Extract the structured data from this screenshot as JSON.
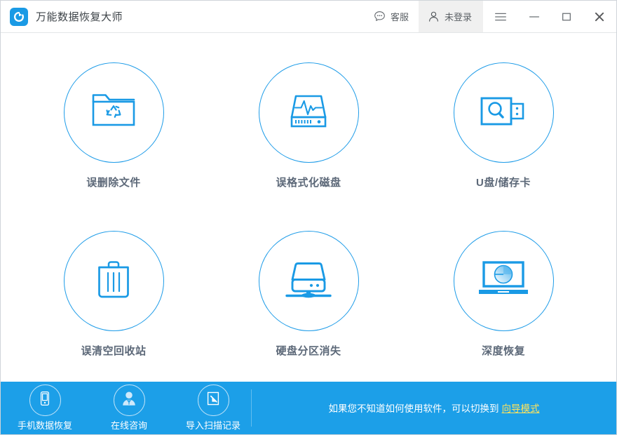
{
  "window": {
    "title": "万能数据恢复大师",
    "logo_icon": "refresh-circle-logo",
    "accent_color": "#1c9fe8",
    "titlebar": {
      "service_label": "客服",
      "service_icon": "chat-bubble-icon",
      "login_label": "未登录",
      "login_icon": "user-icon",
      "menu_icon": "hamburger-menu-icon",
      "minimize_icon": "minimize-icon",
      "maximize_icon": "maximize-icon",
      "close_icon": "close-icon"
    }
  },
  "main": {
    "cards": [
      {
        "label": "误删除文件",
        "icon": "folder-recycle-icon"
      },
      {
        "label": "误格式化磁盘",
        "icon": "disk-waveform-icon"
      },
      {
        "label": "U盘/储存卡",
        "icon": "usb-search-icon"
      },
      {
        "label": "误清空回收站",
        "icon": "trash-bin-icon"
      },
      {
        "label": "硬盘分区消失",
        "icon": "external-drive-icon"
      },
      {
        "label": "深度恢复",
        "icon": "laptop-pie-icon"
      }
    ]
  },
  "footer": {
    "actions": [
      {
        "label": "手机数据恢复",
        "icon": "mobile-phone-icon"
      },
      {
        "label": "在线咨询",
        "icon": "person-avatar-icon"
      },
      {
        "label": "导入扫描记录",
        "icon": "import-arrow-icon"
      }
    ],
    "hint_text": "如果您不知道如何使用软件，可以切换到",
    "hint_link": "向导模式",
    "link_color": "#ffe45c"
  }
}
